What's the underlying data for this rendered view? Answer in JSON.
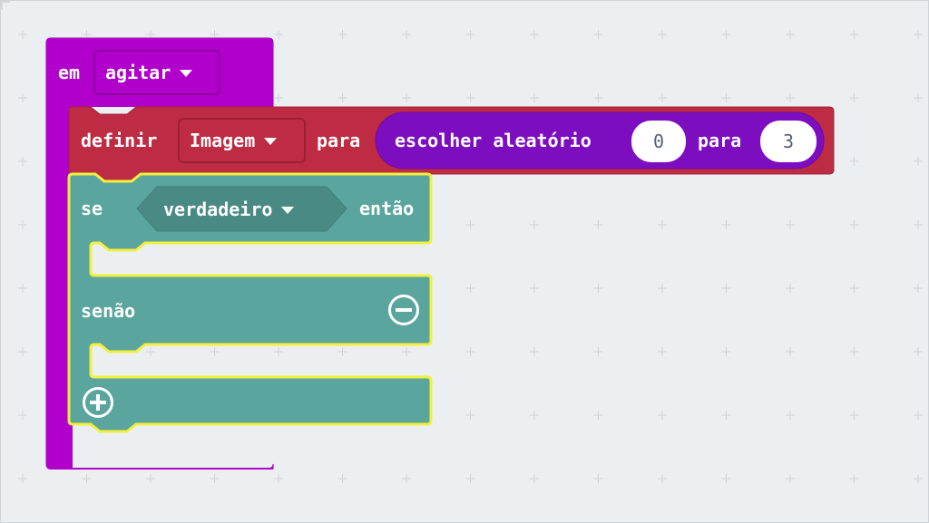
{
  "event_block": {
    "prefix": "em",
    "gesture": "agitar",
    "color": "#b100cb"
  },
  "set_block": {
    "label": "definir",
    "variable": "Imagem",
    "to_label": "para",
    "color": "#bd2c42"
  },
  "random_block": {
    "label": "escolher aleatório",
    "from_value": "0",
    "to_label": "para",
    "to_value": "3",
    "color": "#7d0ec0"
  },
  "if_block": {
    "if_label": "se",
    "condition": "verdadeiro",
    "then_label": "então",
    "else_label": "senão",
    "color": "#5ba59f",
    "highlight": "#f2ef3d"
  },
  "icons": {
    "remove_else": "minus-circle-icon",
    "add_branch": "plus-circle-icon"
  }
}
